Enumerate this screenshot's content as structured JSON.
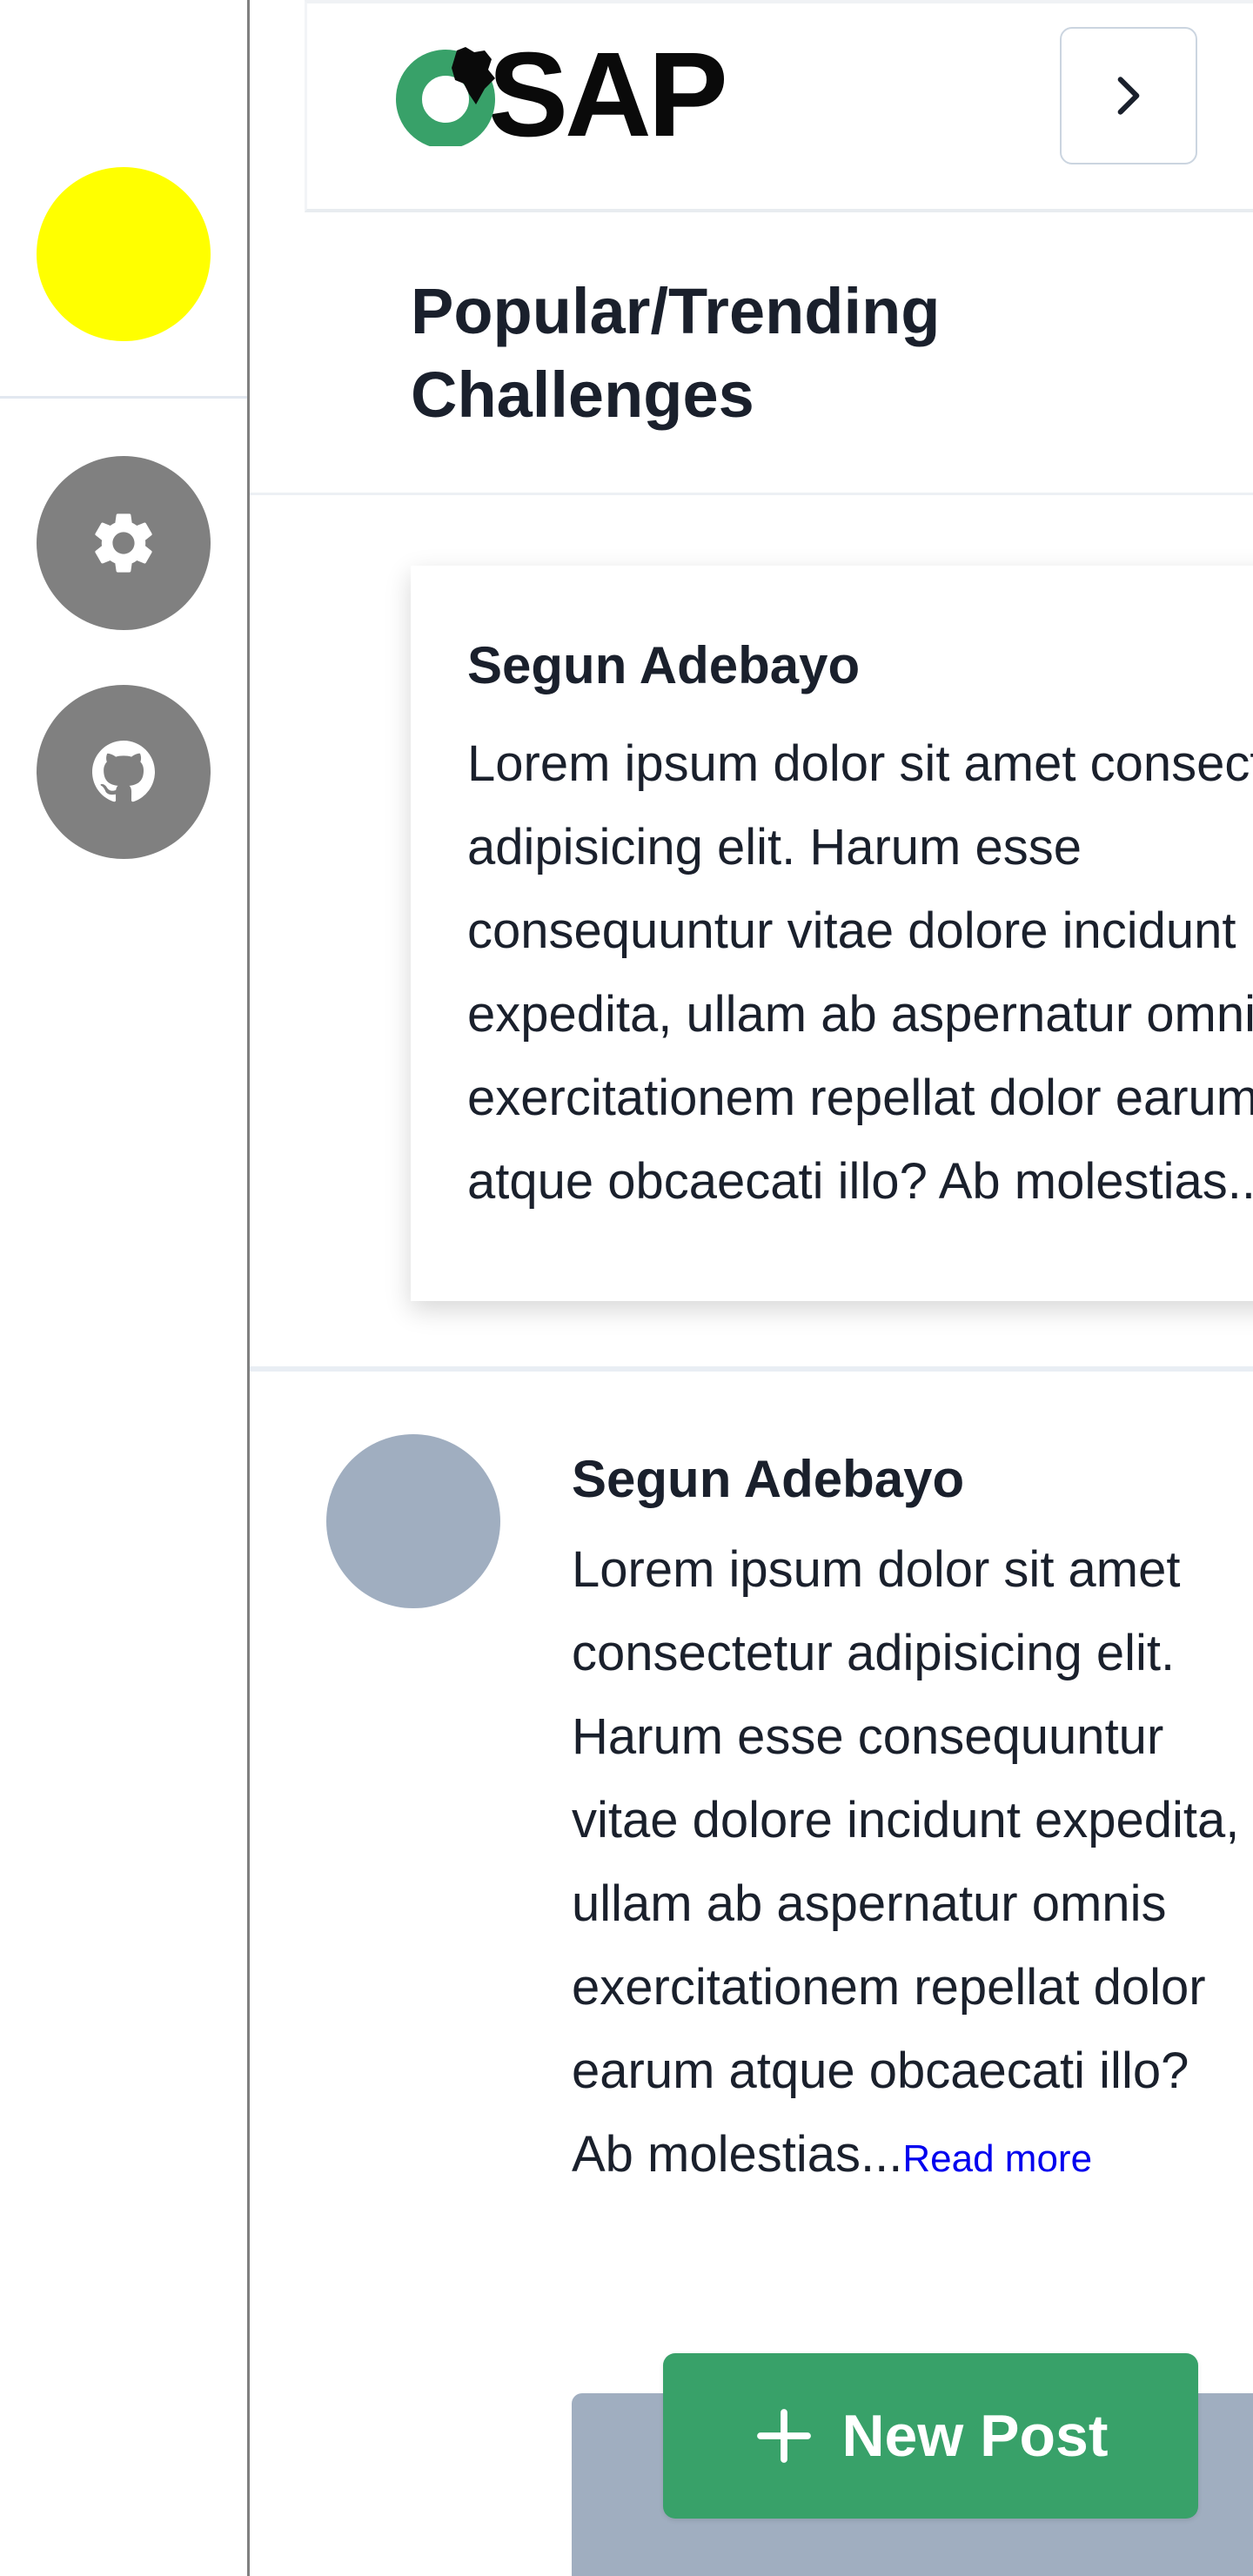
{
  "brand": {
    "logo_text": "SAP",
    "logo_ring_color": "#38a169",
    "logo_text_color": "#0a0a0a"
  },
  "sidebar": {
    "avatar_color": "#ffff00",
    "buttons": [
      {
        "icon": "gear-icon"
      },
      {
        "icon": "github-icon"
      }
    ]
  },
  "header": {
    "expand_icon": "chevron-right-icon"
  },
  "page": {
    "title_line1": "Popular/Trending",
    "title_line2": "Challenges"
  },
  "featured_post": {
    "author": "Segun Adebayo",
    "lines": [
      "Lorem ipsum dolor sit amet consectetur",
      "adipisicing elit. Harum esse",
      "consequuntur vitae dolore incidunt",
      "expedita, ullam ab aspernatur omnis",
      "exercitationem repellat dolor earum",
      "atque obcaecati illo? Ab molestias..."
    ]
  },
  "post": {
    "author": "Segun Adebayo",
    "body": "Lorem ipsum dolor sit amet consectetur adipisicing elit. Harum esse consequuntur vitae dolore incidunt expedita, ullam ab aspernatur omnis exercitationem repellat dolor earum atque obcaecati illo? Ab molestias...",
    "read_more": "Read more"
  },
  "actions": {
    "new_post_label": "New Post",
    "new_post_color": "#38a169"
  }
}
